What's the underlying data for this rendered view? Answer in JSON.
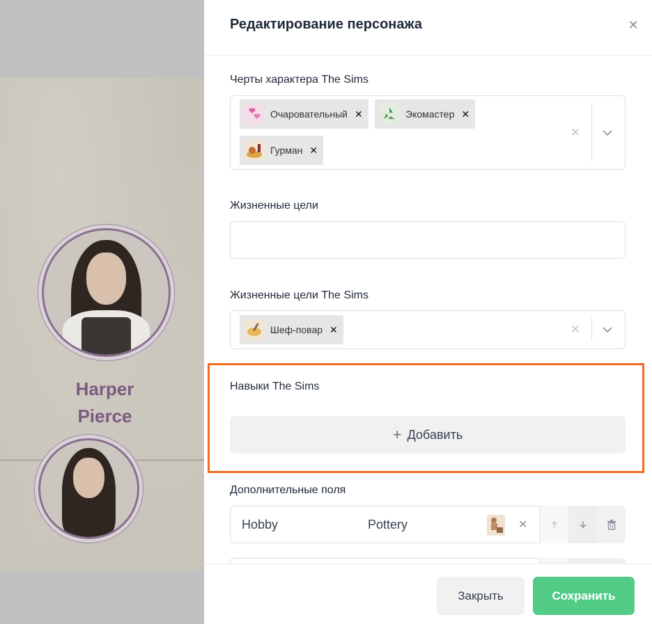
{
  "background": {
    "character_name_line1": "Harper",
    "character_name_line2": "Pierce"
  },
  "drawer": {
    "title": "Редактирование персонажа",
    "close_icon": "close-icon"
  },
  "traits": {
    "label": "Черты характера The Sims",
    "tags": [
      {
        "label": "Очаровательный",
        "icon": "hearts-icon"
      },
      {
        "label": "Экомастер",
        "icon": "recycle-icon"
      },
      {
        "label": "Гурман",
        "icon": "gourmet-plate-icon"
      }
    ]
  },
  "life_goals": {
    "label": "Жизненные цели",
    "value": ""
  },
  "sims_life_goals": {
    "label": "Жизненные цели The Sims",
    "tags": [
      {
        "label": "Шеф-повар",
        "icon": "chef-icon"
      }
    ]
  },
  "skills": {
    "label": "Навыки The Sims",
    "add_label": "Добавить"
  },
  "custom_fields": {
    "label": "Дополнительные поля",
    "rows": [
      {
        "key": "Hobby",
        "value": "Pottery",
        "icon": "pottery-wheel-icon"
      }
    ]
  },
  "footer": {
    "close_label": "Закрыть",
    "save_label": "Сохранить"
  },
  "colors": {
    "accent_highlight": "#f26b1d",
    "save_button": "#52cb87",
    "name_color": "#7a5b80"
  }
}
